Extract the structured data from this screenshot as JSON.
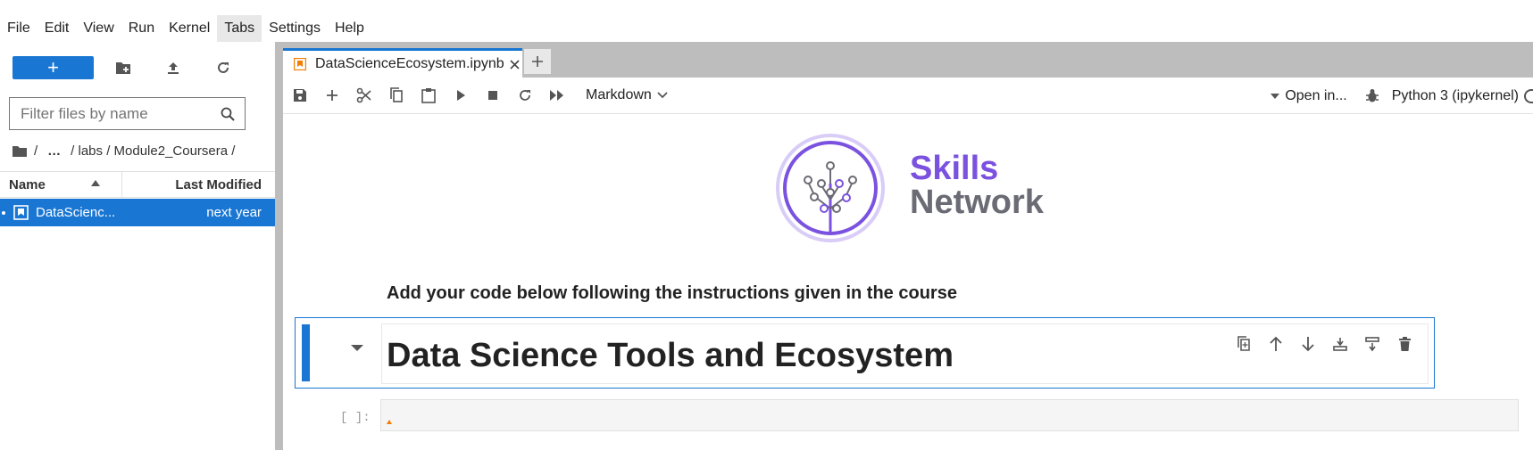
{
  "menu": [
    "File",
    "Edit",
    "View",
    "Run",
    "Kernel",
    "Tabs",
    "Settings",
    "Help"
  ],
  "filebrowser": {
    "new_label": "+",
    "filter_placeholder": "Filter files by name",
    "breadcrumb": [
      "/",
      "…",
      "/ labs / Module2_Coursera /"
    ],
    "col_name": "Name",
    "col_modified": "Last Modified",
    "files": [
      {
        "name": "DataScienc...",
        "modified": "next year"
      }
    ]
  },
  "notebook": {
    "tab_title": "DataScienceEcosystem.ipynb",
    "cell_type": "Markdown",
    "open_in": "Open in...",
    "kernel": "Python 3 (ipykernel)",
    "logo_top": "Skills",
    "logo_bottom": "Network",
    "instructions": "Add your code below following the instructions given in the course",
    "heading": "Data Science Tools and Ecosystem",
    "prompt": "[ ]:"
  },
  "colors": {
    "accent": "#1976d2",
    "logo_purple": "#7b52e0",
    "logo_gray": "#6b6b75"
  }
}
